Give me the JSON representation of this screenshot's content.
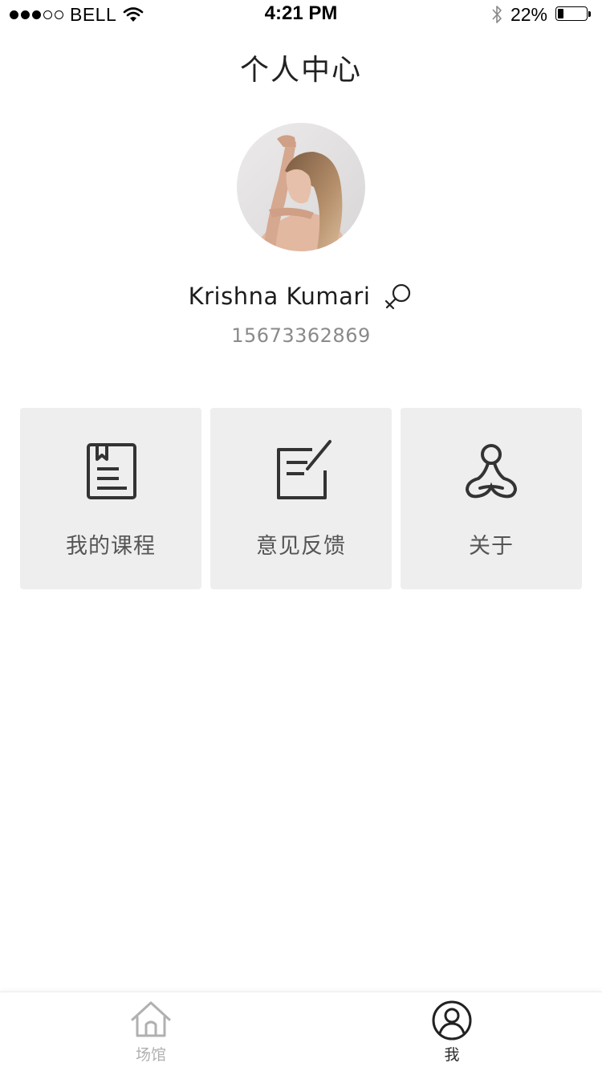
{
  "status_bar": {
    "carrier": "BELL",
    "time": "4:21 PM",
    "battery_text": "22%",
    "battery_level": 0.22,
    "signal_bars_filled": 3,
    "signal_bars_total": 5
  },
  "header": {
    "title": "个人中心"
  },
  "profile": {
    "name": "Krishna Kumari",
    "phone": "15673362869",
    "gender_icon": "female-symbol-icon"
  },
  "menu": [
    {
      "label": "我的课程",
      "icon": "book-icon"
    },
    {
      "label": "意见反馈",
      "icon": "feedback-edit-icon"
    },
    {
      "label": "关于",
      "icon": "yoga-lotus-icon"
    }
  ],
  "tab_bar": {
    "tabs": [
      {
        "label": "场馆",
        "icon": "home-icon",
        "active": false
      },
      {
        "label": "我",
        "icon": "user-icon",
        "active": true
      }
    ]
  },
  "colors": {
    "card_background": "#eeeeee",
    "tab_active": "#2b2b2b",
    "tab_inactive": "#b0b0b0",
    "phone_text": "#8a8a8a"
  }
}
